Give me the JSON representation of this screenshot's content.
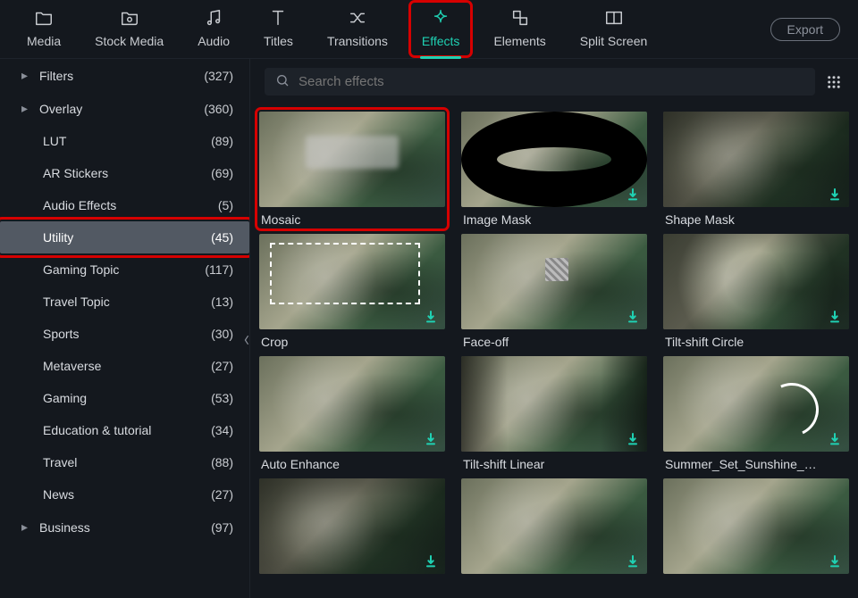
{
  "colors": {
    "accent": "#1fd1b3",
    "highlight": "#d60000",
    "bg": "#14181e"
  },
  "topbar": {
    "tabs": [
      {
        "id": "media",
        "label": "Media",
        "icon": "folder-icon"
      },
      {
        "id": "stock",
        "label": "Stock Media",
        "icon": "cloud-folder-icon"
      },
      {
        "id": "audio",
        "label": "Audio",
        "icon": "music-icon"
      },
      {
        "id": "titles",
        "label": "Titles",
        "icon": "text-icon"
      },
      {
        "id": "transitions",
        "label": "Transitions",
        "icon": "shuffle-icon"
      },
      {
        "id": "effects",
        "label": "Effects",
        "icon": "sparkle-icon",
        "active": true,
        "highlight": true
      },
      {
        "id": "elements",
        "label": "Elements",
        "icon": "shapes-icon"
      },
      {
        "id": "split",
        "label": "Split Screen",
        "icon": "layout-icon"
      }
    ],
    "export_label": "Export"
  },
  "sidebar": {
    "items": [
      {
        "label": "Filters",
        "count": "(327)",
        "expandable": true,
        "child": false
      },
      {
        "label": "Overlay",
        "count": "(360)",
        "expandable": true,
        "child": false
      },
      {
        "label": "LUT",
        "count": "(89)",
        "expandable": false,
        "child": true
      },
      {
        "label": "AR Stickers",
        "count": "(69)",
        "expandable": false,
        "child": true
      },
      {
        "label": "Audio Effects",
        "count": "(5)",
        "expandable": false,
        "child": true
      },
      {
        "label": "Utility",
        "count": "(45)",
        "expandable": false,
        "child": true,
        "selected": true,
        "highlight": true
      },
      {
        "label": "Gaming Topic",
        "count": "(117)",
        "expandable": false,
        "child": true
      },
      {
        "label": "Travel Topic",
        "count": "(13)",
        "expandable": false,
        "child": true
      },
      {
        "label": "Sports",
        "count": "(30)",
        "expandable": false,
        "child": true
      },
      {
        "label": "Metaverse",
        "count": "(27)",
        "expandable": false,
        "child": true
      },
      {
        "label": "Gaming",
        "count": "(53)",
        "expandable": false,
        "child": true
      },
      {
        "label": "Education & tutorial",
        "count": "(34)",
        "expandable": false,
        "child": true
      },
      {
        "label": "Travel",
        "count": "(88)",
        "expandable": false,
        "child": true
      },
      {
        "label": "News",
        "count": "(27)",
        "expandable": false,
        "child": true
      },
      {
        "label": "Business",
        "count": "(97)",
        "expandable": true,
        "child": false
      }
    ]
  },
  "search": {
    "placeholder": "Search effects"
  },
  "grid": {
    "items": [
      {
        "label": "Mosaic",
        "fx": "blur",
        "download": false,
        "highlight": true
      },
      {
        "label": "Image Mask",
        "fx": "oval",
        "download": true
      },
      {
        "label": "Shape Mask",
        "fx": "vig",
        "download": true
      },
      {
        "label": "Crop",
        "fx": "crop",
        "download": true
      },
      {
        "label": "Face-off",
        "fx": "face",
        "download": true
      },
      {
        "label": "Tilt-shift Circle",
        "fx": "radial",
        "download": true
      },
      {
        "label": "Auto Enhance",
        "fx": "none",
        "download": true
      },
      {
        "label": "Tilt-shift Linear",
        "fx": "linear",
        "download": true
      },
      {
        "label": "Summer_Set_Sunshine_…",
        "fx": "arc",
        "download": true
      },
      {
        "label": "",
        "fx": "vig",
        "download": true
      },
      {
        "label": "",
        "fx": "none",
        "download": true
      },
      {
        "label": "",
        "fx": "none",
        "download": true
      }
    ]
  }
}
